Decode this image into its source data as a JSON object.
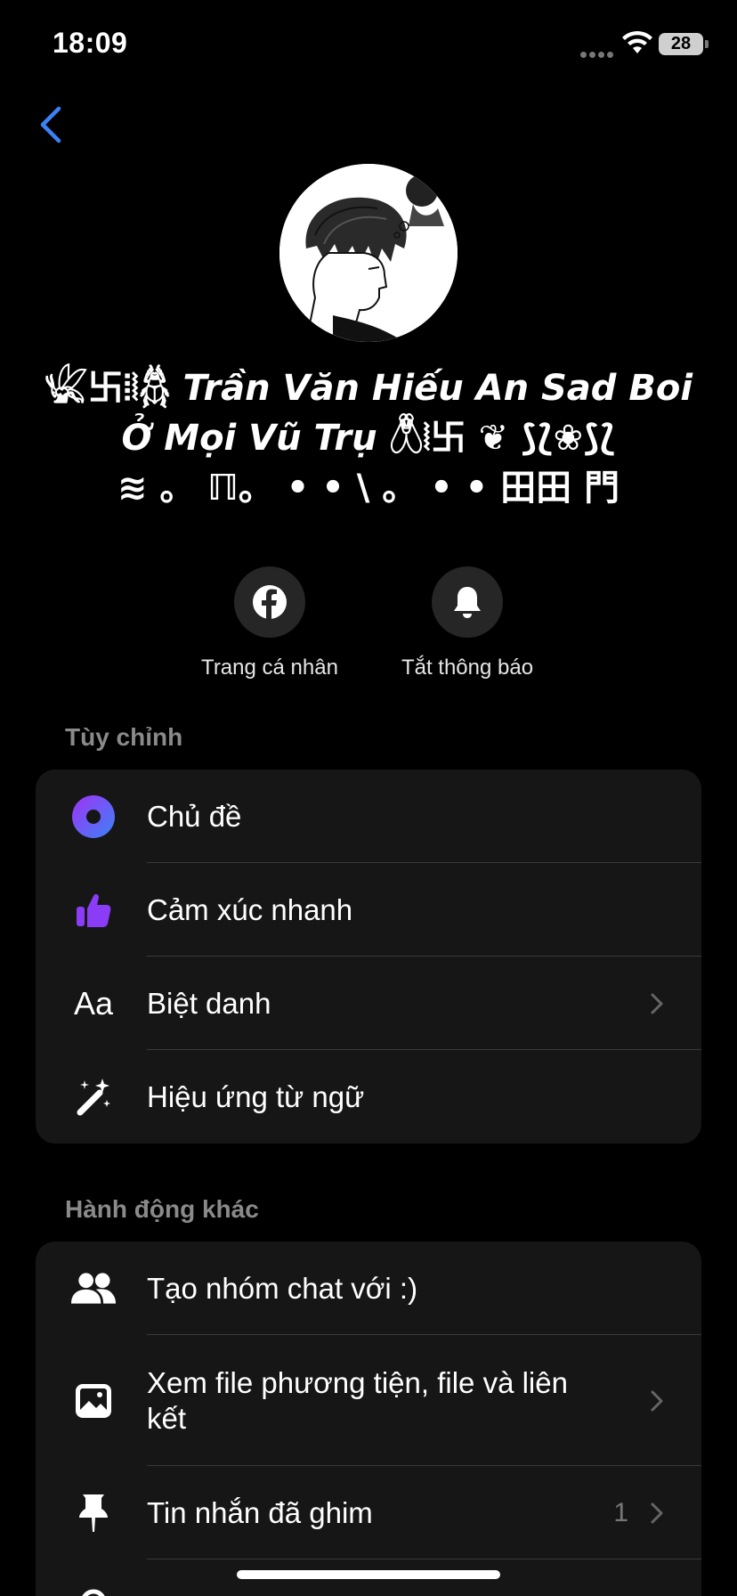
{
  "status": {
    "time": "18:09",
    "battery": "28"
  },
  "profile": {
    "name_prefix": "𓆤卐⦙⦚𓆣 ",
    "name_main_1": "Trần Văn Hiếu An Sad Boi",
    "name_main_2": "Ở Mọi Vũ Trụ ",
    "name_suffix_2": "𓆦⦚卐 ❦ ⟆⟅❀⟆⟅",
    "name_line_3": "≋ 。 ℿ。 • • \\ 。 • • 田田 門"
  },
  "actions": [
    {
      "label": "Trang cá nhân",
      "icon": "facebook-icon"
    },
    {
      "label": "Tắt thông báo",
      "icon": "bell-icon"
    }
  ],
  "sections": {
    "customize": {
      "title": "Tùy chỉnh",
      "items": [
        {
          "label": "Chủ đề",
          "icon": "theme-circle-icon"
        },
        {
          "label": "Cảm xúc nhanh",
          "icon": "thumbs-up-icon"
        },
        {
          "label": "Biệt danh",
          "icon": "text-aa-icon",
          "icon_text": "Aa",
          "chevron": true
        },
        {
          "label": "Hiệu ứng từ ngữ",
          "icon": "magic-wand-icon"
        }
      ]
    },
    "other": {
      "title": "Hành động khác",
      "items": [
        {
          "label": "Tạo nhóm chat với :)",
          "icon": "people-icon"
        },
        {
          "label": "Xem file phương tiện, file và liên kết",
          "icon": "image-icon",
          "chevron": true
        },
        {
          "label": "Tin nhắn đã ghim",
          "icon": "pin-icon",
          "count": "1",
          "chevron": true
        }
      ]
    }
  },
  "colors": {
    "accent": "#3b82f6",
    "thumbs": "#8b3cf7",
    "card": "#161616",
    "section_title": "#8a8a8a"
  }
}
